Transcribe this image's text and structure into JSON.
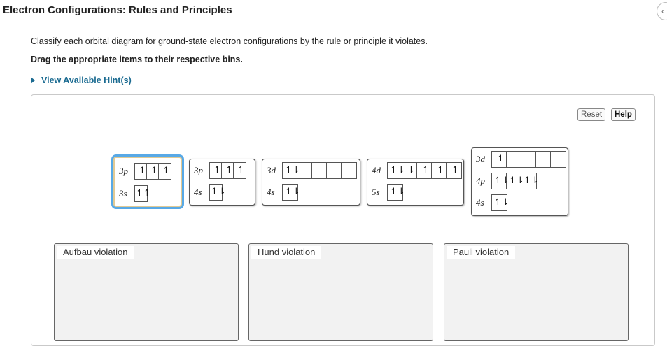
{
  "header": {
    "title": "Electron Configurations: Rules and Principles"
  },
  "instructions": {
    "text": "Classify each orbital diagram for ground-state electron configurations by the rule or principle it violates.",
    "bold": "Drag the appropriate items to their respective bins."
  },
  "hint": {
    "label": "View Available Hint(s)"
  },
  "toolbar": {
    "reset": "Reset",
    "help": "Help"
  },
  "cards": [
    {
      "rows": [
        {
          "label": "3p",
          "boxes": [
            "↿",
            "↿",
            "↿"
          ]
        },
        {
          "label": "3s",
          "boxes": [
            "↿↿"
          ]
        }
      ]
    },
    {
      "rows": [
        {
          "label": "3p",
          "boxes": [
            "↿",
            "↿",
            "↿"
          ]
        },
        {
          "label": "4s",
          "boxes": [
            "↿⇂"
          ]
        }
      ]
    },
    {
      "rows": [
        {
          "label": "3d",
          "boxes": [
            "↿⇂",
            "",
            "",
            "",
            ""
          ]
        },
        {
          "label": "4s",
          "boxes": [
            "↿⇂"
          ]
        }
      ]
    },
    {
      "rows": [
        {
          "label": "4d",
          "boxes": [
            "↿⇂",
            "⇂",
            "↿",
            "↿",
            "↿"
          ]
        },
        {
          "label": "5s",
          "boxes": [
            "↿⇂"
          ]
        }
      ]
    },
    {
      "rows": [
        {
          "label": "3d",
          "boxes": [
            "↿",
            "",
            "",
            "",
            ""
          ]
        },
        {
          "label": "4p",
          "boxes": [
            "↿⇂",
            "↿⇂",
            "↿⇂"
          ]
        },
        {
          "label": "4s",
          "boxes": [
            "↿⇂"
          ]
        }
      ]
    }
  ],
  "bins": [
    {
      "label": "Aufbau violation"
    },
    {
      "label": "Hund violation"
    },
    {
      "label": "Pauli violation"
    }
  ]
}
